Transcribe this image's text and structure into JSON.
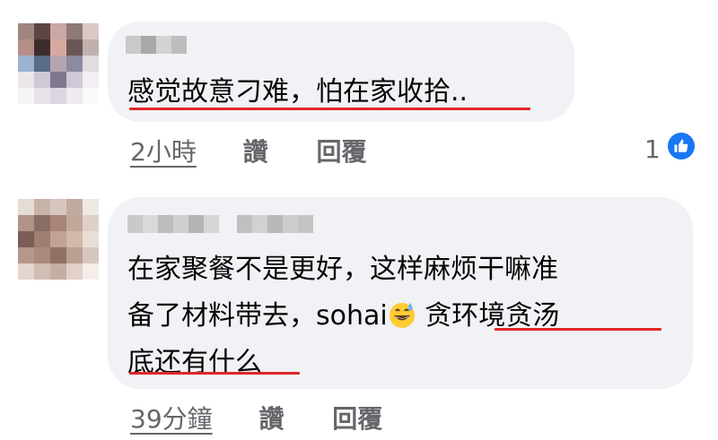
{
  "comments": [
    {
      "text_lines": [
        "感觉故意刁难，怕在家收拾.."
      ],
      "time": "2小時",
      "like_label": "讚",
      "reply_label": "回覆",
      "reaction_count": "1"
    },
    {
      "text_line1": "在家聚餐不是更好，这样麻烦干嘛准",
      "text_line2_pre": "备了材料带去，sohai",
      "text_line2_post": " 贪环境贪汤",
      "text_line3": "底还有什么",
      "time": "39分鐘",
      "like_label": "讚",
      "reply_label": "回覆"
    }
  ],
  "colors": {
    "bubble": "#f0f2f5",
    "meta_text": "#65676b",
    "highlight_underline": "#e0262a",
    "like_badge": "#1877f2"
  },
  "icons": {
    "reaction": "thumbs-up-icon",
    "emoji": "grinning-sweat-emoji-icon"
  }
}
